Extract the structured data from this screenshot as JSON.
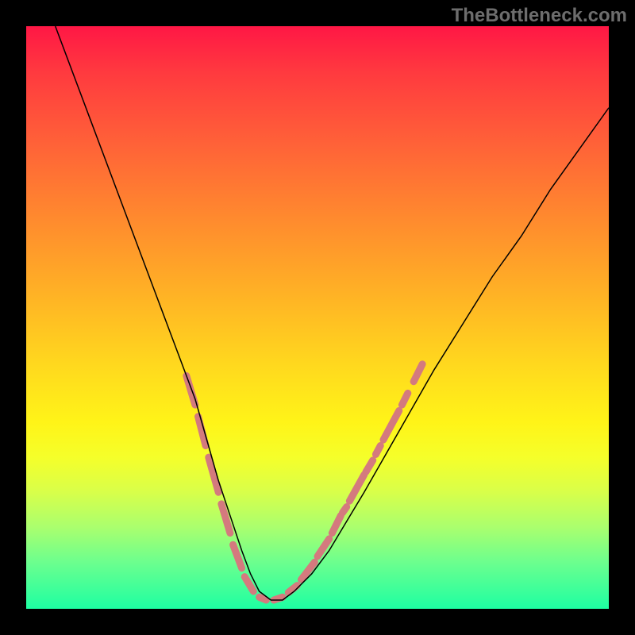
{
  "watermark": "TheBottleneck.com",
  "chart_data": {
    "type": "line",
    "title": "",
    "xlabel": "",
    "ylabel": "",
    "xlim": [
      0,
      100
    ],
    "ylim": [
      0,
      100
    ],
    "grid": false,
    "gradient_stops": [
      {
        "pos": 0,
        "color": "#ff1745"
      },
      {
        "pos": 8,
        "color": "#ff3a3f"
      },
      {
        "pos": 20,
        "color": "#ff6138"
      },
      {
        "pos": 33,
        "color": "#ff8a2e"
      },
      {
        "pos": 46,
        "color": "#ffb225"
      },
      {
        "pos": 58,
        "color": "#ffd81e"
      },
      {
        "pos": 68,
        "color": "#fff418"
      },
      {
        "pos": 74,
        "color": "#f5ff2a"
      },
      {
        "pos": 80,
        "color": "#d8ff4a"
      },
      {
        "pos": 86,
        "color": "#aaff6e"
      },
      {
        "pos": 92,
        "color": "#6cff8e"
      },
      {
        "pos": 100,
        "color": "#1effa2"
      }
    ],
    "series": [
      {
        "name": "curve",
        "color": "#000000",
        "stroke_width": 1.5,
        "x": [
          5,
          8,
          11,
          14,
          17,
          20,
          23,
          26,
          29,
          31,
          33,
          35,
          37,
          38.5,
          40,
          42,
          44,
          46,
          49,
          52,
          55,
          58,
          62,
          66,
          70,
          75,
          80,
          85,
          90,
          95,
          100
        ],
        "y": [
          100,
          92,
          84,
          76,
          68,
          60,
          52,
          44,
          36,
          29,
          22,
          16,
          10,
          6,
          3,
          1.5,
          1.5,
          3,
          6,
          10,
          15,
          20,
          27,
          34,
          41,
          49,
          57,
          64,
          72,
          79,
          86
        ]
      }
    ],
    "markers": {
      "name": "pink-segments",
      "color": "#d47a7e",
      "stroke_width": 9,
      "segments": [
        {
          "x1": 27.5,
          "y1": 40,
          "x2": 29.0,
          "y2": 35
        },
        {
          "x1": 29.5,
          "y1": 33,
          "x2": 30.8,
          "y2": 28
        },
        {
          "x1": 31.3,
          "y1": 26,
          "x2": 33.0,
          "y2": 20
        },
        {
          "x1": 33.5,
          "y1": 18,
          "x2": 35.0,
          "y2": 13
        },
        {
          "x1": 35.5,
          "y1": 11,
          "x2": 37.0,
          "y2": 7
        },
        {
          "x1": 37.5,
          "y1": 5.5,
          "x2": 39.0,
          "y2": 3.0
        },
        {
          "x1": 40.0,
          "y1": 2.0,
          "x2": 41.2,
          "y2": 1.5
        },
        {
          "x1": 42.5,
          "y1": 1.5,
          "x2": 44.0,
          "y2": 2.0
        },
        {
          "x1": 45.0,
          "y1": 2.8,
          "x2": 46.5,
          "y2": 4.0
        },
        {
          "x1": 47.2,
          "y1": 5.0,
          "x2": 49.5,
          "y2": 8.0
        },
        {
          "x1": 50.0,
          "y1": 9.0,
          "x2": 52.0,
          "y2": 12.0
        },
        {
          "x1": 52.5,
          "y1": 13.0,
          "x2": 54.0,
          "y2": 16.0
        },
        {
          "x1": 54.3,
          "y1": 16.5,
          "x2": 55.0,
          "y2": 17.5
        },
        {
          "x1": 55.5,
          "y1": 18.5,
          "x2": 58.0,
          "y2": 23.0
        },
        {
          "x1": 58.3,
          "y1": 23.5,
          "x2": 59.5,
          "y2": 25.5
        },
        {
          "x1": 60.0,
          "y1": 26.5,
          "x2": 60.8,
          "y2": 28.0
        },
        {
          "x1": 61.3,
          "y1": 29.0,
          "x2": 64.0,
          "y2": 34.0
        },
        {
          "x1": 64.5,
          "y1": 35.0,
          "x2": 65.5,
          "y2": 37.0
        },
        {
          "x1": 66.5,
          "y1": 39.0,
          "x2": 68.0,
          "y2": 42.0
        }
      ]
    }
  }
}
